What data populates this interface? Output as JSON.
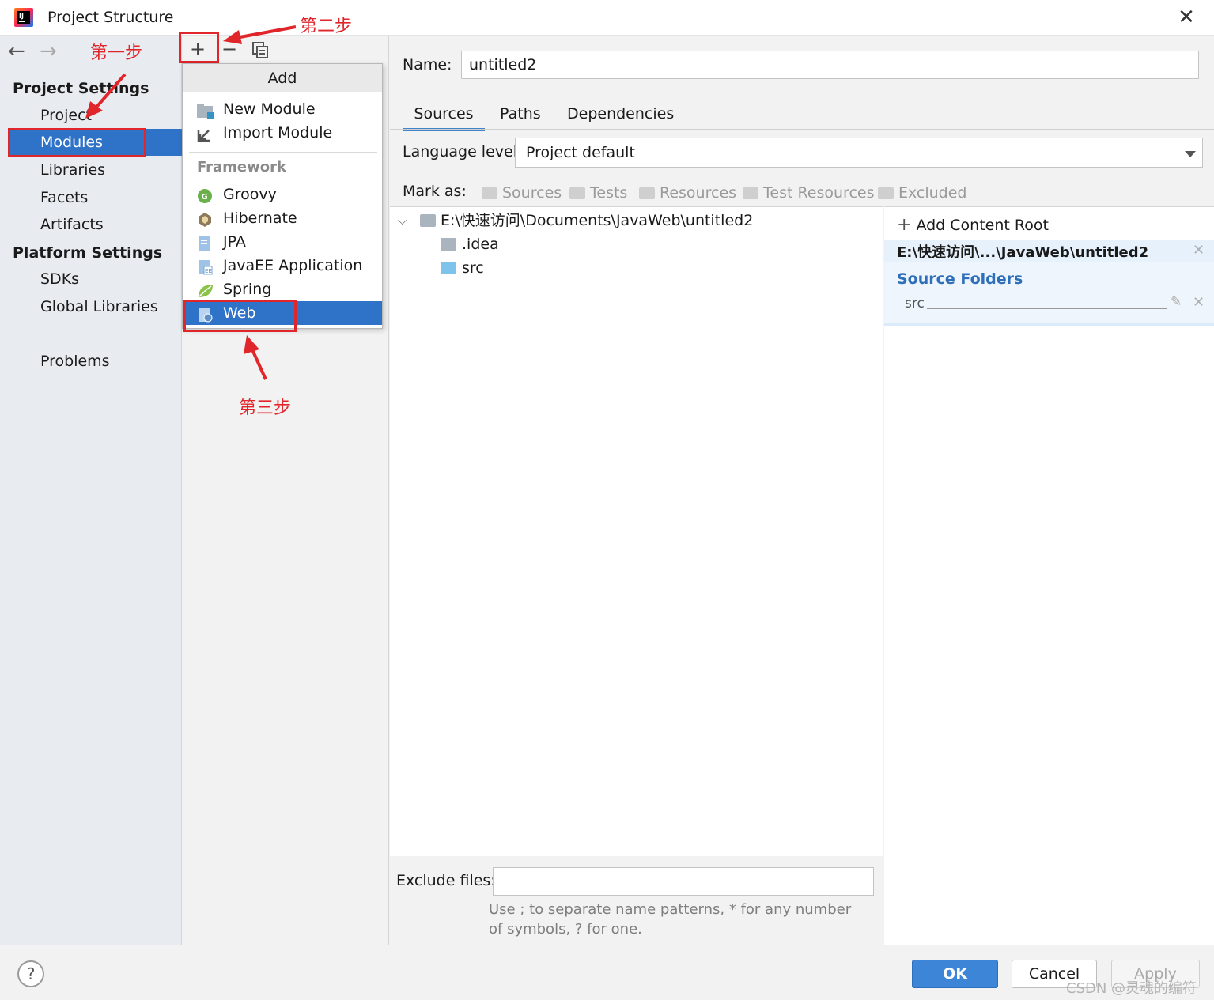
{
  "window": {
    "title": "Project Structure",
    "close": "✕"
  },
  "nav": {
    "back": "←",
    "forward": "→"
  },
  "sidebar": {
    "project_settings_header": "Project Settings",
    "project_settings_items": [
      {
        "label": "Project"
      },
      {
        "label": "Modules",
        "selected": true
      },
      {
        "label": "Libraries"
      },
      {
        "label": "Facets"
      },
      {
        "label": "Artifacts"
      }
    ],
    "platform_settings_header": "Platform Settings",
    "platform_settings_items": [
      {
        "label": "SDKs"
      },
      {
        "label": "Global Libraries"
      }
    ],
    "problems": "Problems"
  },
  "toolbar": {
    "add": "+",
    "remove": "−"
  },
  "popup": {
    "title": "Add",
    "items": [
      {
        "label": "New Module",
        "icon": "module-folder-icon"
      },
      {
        "label": "Import Module",
        "icon": "import-arrow-icon"
      }
    ],
    "framework_header": "Framework",
    "framework_items": [
      {
        "label": "Groovy",
        "icon": "groovy-icon"
      },
      {
        "label": "Hibernate",
        "icon": "hibernate-icon"
      },
      {
        "label": "JPA",
        "icon": "jpa-icon"
      },
      {
        "label": "JavaEE Application",
        "icon": "javaee-icon"
      },
      {
        "label": "Spring",
        "icon": "spring-leaf-icon"
      },
      {
        "label": "Web",
        "icon": "web-icon",
        "selected": true
      }
    ]
  },
  "annotations": {
    "step1": "第一步",
    "step2": "第二步",
    "step3": "第三步",
    "color": "#e0252b"
  },
  "module": {
    "name_label": "Name:",
    "name_value": "untitled2",
    "tabs": [
      {
        "label": "Sources",
        "active": true
      },
      {
        "label": "Paths"
      },
      {
        "label": "Dependencies"
      }
    ],
    "language_level_label": "Language level:",
    "language_level_value": "Project default",
    "mark_as_label": "Mark as:",
    "mark_as_options": [
      "Sources",
      "Tests",
      "Resources",
      "Test Resources",
      "Excluded"
    ],
    "tree": {
      "root": "E:\\快速访问\\Documents\\JavaWeb\\untitled2",
      "children": [
        ".idea",
        "src"
      ]
    },
    "content_root": {
      "add_label": "Add Content Root",
      "path": "E:\\快速访问\\...\\JavaWeb\\untitled2",
      "source_folders_title": "Source Folders",
      "source_folders": [
        "src"
      ]
    },
    "exclude_label": "Exclude files:",
    "exclude_value": "",
    "exclude_hint": "Use ; to separate name patterns, * for any number of symbols, ? for one."
  },
  "footer": {
    "help": "?",
    "ok": "OK",
    "cancel": "Cancel",
    "apply": "Apply",
    "watermark": "CSDN @灵魂的编符"
  },
  "colors": {
    "selection": "#2f73c9",
    "accent": "#4083c9",
    "ok_button": "#3d85d6",
    "annotation_red": "#e0252b"
  }
}
